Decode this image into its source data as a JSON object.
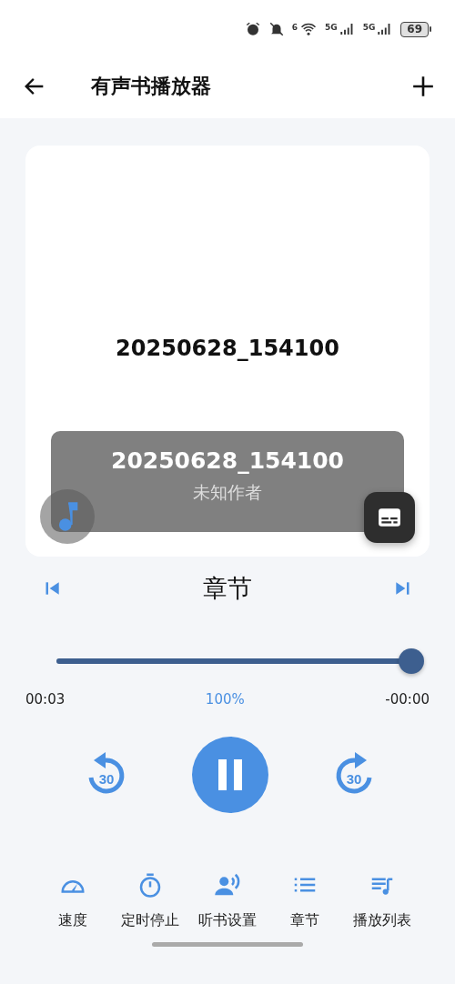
{
  "status_bar": {
    "wifi_label": "6",
    "signals": [
      {
        "label": "5G"
      },
      {
        "label": "5G"
      }
    ],
    "battery": "69"
  },
  "header": {
    "title": "有声书播放器"
  },
  "cover": {
    "title": "20250628_154100",
    "overlay_title": "20250628_154100",
    "author": "未知作者"
  },
  "chapter": {
    "title": "章节"
  },
  "progress": {
    "level": 1,
    "elapsed": "00:03",
    "speed": "100%",
    "remaining": "-00:00"
  },
  "controls": {
    "rewind": "30",
    "forward": "30",
    "playing": true
  },
  "nav": [
    {
      "kind": "speed",
      "label": "速度"
    },
    {
      "kind": "timer",
      "label": "定时停止"
    },
    {
      "kind": "voice",
      "label": "听书设置"
    },
    {
      "kind": "chapters",
      "label": "章节"
    },
    {
      "kind": "playlist",
      "label": "播放列表"
    }
  ]
}
